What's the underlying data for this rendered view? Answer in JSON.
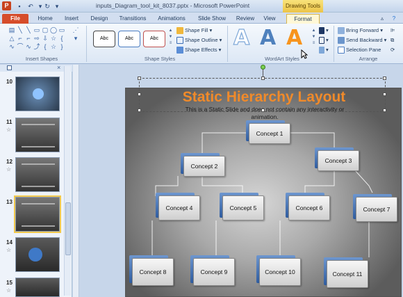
{
  "window": {
    "title": "inputs_Diagram_tool_kit_8037.pptx - Microsoft PowerPoint",
    "context_tab_group": "Drawing Tools",
    "app_icon_letter": "P"
  },
  "tabs": [
    "File",
    "Home",
    "Insert",
    "Design",
    "Transitions",
    "Animations",
    "Slide Show",
    "Review",
    "View",
    "Format"
  ],
  "ribbon": {
    "insert_shapes_label": "Insert Shapes",
    "shape_styles_label": "Shape Styles",
    "style_presets": [
      "Abc",
      "Abc",
      "Abc"
    ],
    "shape_fill": "Shape Fill",
    "shape_outline": "Shape Outline",
    "shape_effects": "Shape Effects",
    "wordart_label": "WordArt Styles",
    "wordart_letter": "A",
    "bring_forward": "Bring Forward",
    "send_backward": "Send Backward",
    "selection_pane": "Selection Pane",
    "arrange_label": "Arrange"
  },
  "thumbnails": [
    {
      "number": "10",
      "star": false
    },
    {
      "number": "11",
      "star": true
    },
    {
      "number": "12",
      "star": true
    },
    {
      "number": "13",
      "star": false,
      "selected": true
    },
    {
      "number": "14",
      "star": true
    },
    {
      "number": "15",
      "star": true
    }
  ],
  "slide": {
    "title": "Static Hierarchy Layout",
    "subtitle": "This is a Static Slide and does not contain any interactivity or animation.",
    "concepts": [
      "Concept 1",
      "Concept 2",
      "Concept 3",
      "Concept 4",
      "Concept 5",
      "Concept 6",
      "Concept 7",
      "Concept 8",
      "Concept 9",
      "Concept 10",
      "Concept 11"
    ]
  },
  "colors": {
    "file_tab": "#d64d2b",
    "slide_title": "#f08a2a",
    "concept_blue": "#2f5c9f",
    "drawing_tools": "#ecc448"
  }
}
